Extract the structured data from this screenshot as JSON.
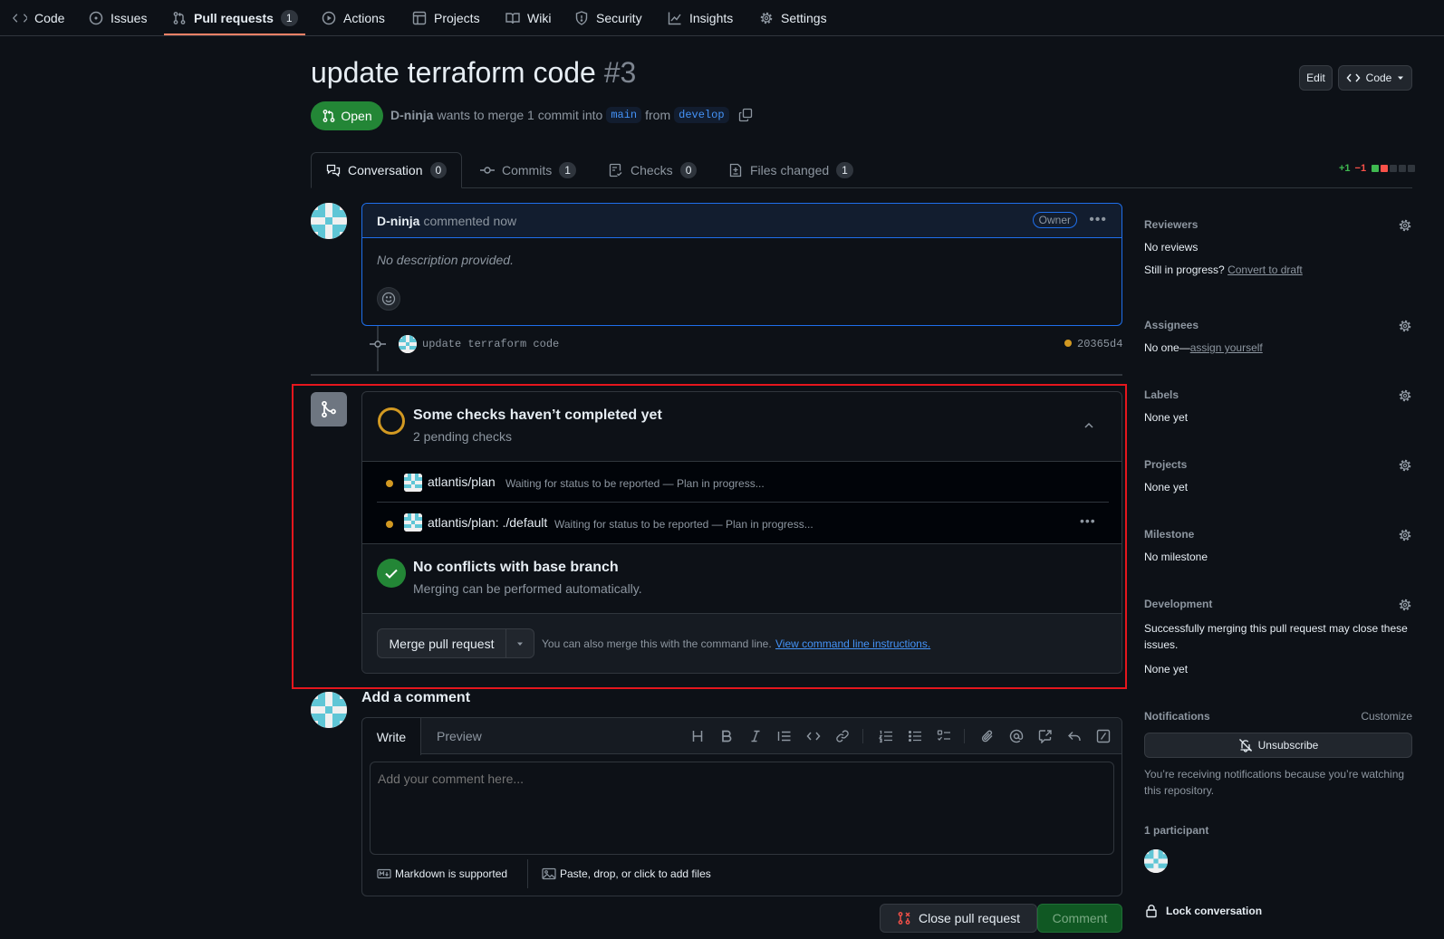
{
  "nav": {
    "items": [
      {
        "label": "Code",
        "icon": "code-icon"
      },
      {
        "label": "Issues",
        "icon": "issue-opened-icon"
      },
      {
        "label": "Pull requests",
        "icon": "git-pull-request-icon",
        "count": "1",
        "active": true
      },
      {
        "label": "Actions",
        "icon": "play-icon"
      },
      {
        "label": "Projects",
        "icon": "table-icon"
      },
      {
        "label": "Wiki",
        "icon": "book-icon"
      },
      {
        "label": "Security",
        "icon": "shield-icon"
      },
      {
        "label": "Insights",
        "icon": "graph-icon"
      },
      {
        "label": "Settings",
        "icon": "gear-icon"
      }
    ]
  },
  "pr": {
    "title": "update terraform code",
    "number": "#3",
    "state": "Open",
    "author": "D-ninja",
    "merge_text": "wants to merge 1 commit into",
    "base": "main",
    "from_text": "from",
    "head": "develop",
    "edit_label": "Edit",
    "code_label": "Code"
  },
  "tabs": [
    {
      "label": "Conversation",
      "count": "0",
      "icon": "comment-discussion-icon",
      "active": true
    },
    {
      "label": "Commits",
      "count": "1",
      "icon": "git-commit-icon"
    },
    {
      "label": "Checks",
      "count": "0",
      "icon": "checklist-icon"
    },
    {
      "label": "Files changed",
      "count": "1",
      "icon": "file-diff-icon"
    }
  ],
  "diffstat": {
    "additions": "+1",
    "deletions": "−1",
    "colors": {
      "add": "#3fb950",
      "del": "#f85149",
      "neutral": "#30363d"
    }
  },
  "comment": {
    "author": "D-ninja",
    "action": "commented now",
    "badge": "Owner",
    "body": "No description provided."
  },
  "commit": {
    "message": "update terraform code",
    "sha": "20365d4"
  },
  "checks": {
    "title": "Some checks haven’t completed yet",
    "subtitle": "2 pending checks",
    "items": [
      {
        "name": "atlantis/plan",
        "status": "Waiting for status to be reported — Plan in progress..."
      },
      {
        "name": "atlantis/plan: ./default",
        "status": "Waiting for status to be reported — Plan in progress..."
      }
    ]
  },
  "conflicts": {
    "title": "No conflicts with base branch",
    "subtitle": "Merging can be performed automatically."
  },
  "merge": {
    "button": "Merge pull request",
    "hint": "You can also merge this with the command line.",
    "link": "View command line instructions."
  },
  "add_comment": {
    "title": "Add a comment",
    "write_tab": "Write",
    "preview_tab": "Preview",
    "placeholder": "Add your comment here...",
    "markdown_note": "Markdown is supported",
    "files_note": "Paste, drop, or click to add files",
    "close_button": "Close pull request",
    "comment_button": "Comment"
  },
  "sidebar": {
    "reviewers": {
      "title": "Reviewers",
      "value": "No reviews",
      "draft_prefix": "Still in progress?",
      "draft_link": "Convert to draft"
    },
    "assignees": {
      "title": "Assignees",
      "value": "No one—",
      "link": "assign yourself"
    },
    "labels": {
      "title": "Labels",
      "value": "None yet"
    },
    "projects": {
      "title": "Projects",
      "value": "None yet"
    },
    "milestone": {
      "title": "Milestone",
      "value": "No milestone"
    },
    "development": {
      "title": "Development",
      "text": "Successfully merging this pull request may close these issues.",
      "value": "None yet"
    },
    "notifications": {
      "title": "Notifications",
      "customize": "Customize",
      "button": "Unsubscribe",
      "note": "You’re receiving notifications because you’re watching this repository."
    },
    "participants": {
      "title": "1 participant"
    },
    "lock": "Lock conversation"
  }
}
